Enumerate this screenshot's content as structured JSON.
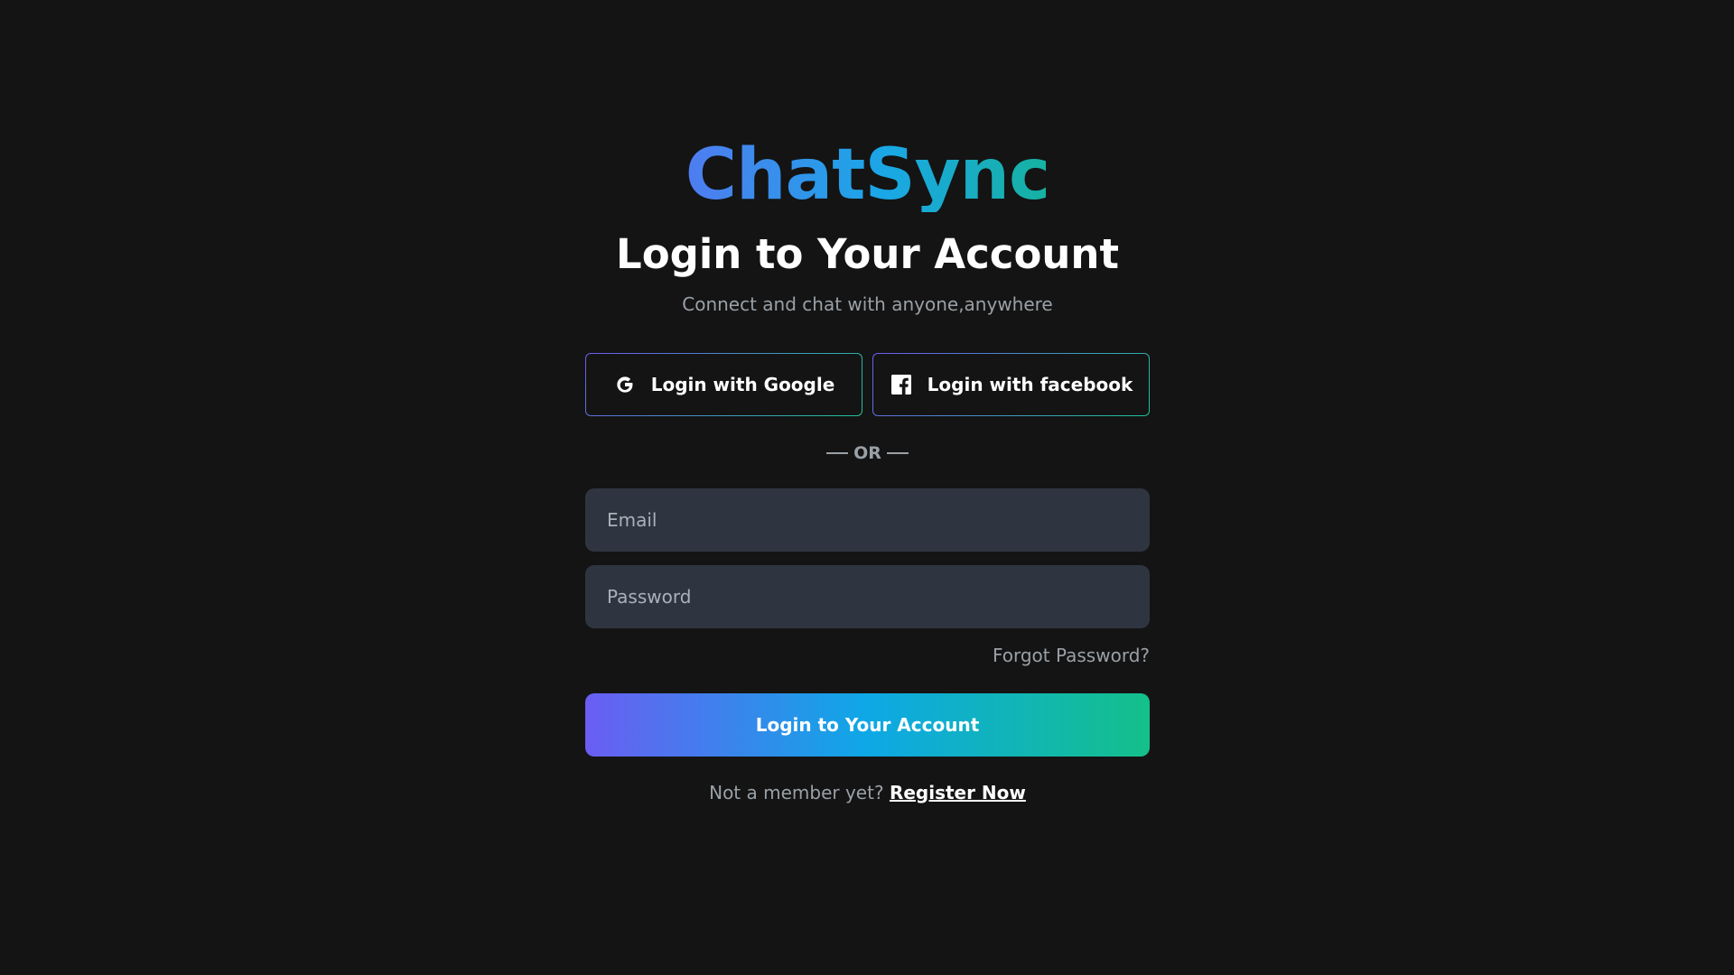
{
  "brand": {
    "name": "ChatSync"
  },
  "header": {
    "title": "Login to Your Account",
    "subtitle": "Connect and chat with anyone,anywhere"
  },
  "social": {
    "google_label": "Login with Google",
    "google_icon": "google-icon",
    "facebook_label": "Login with facebook",
    "facebook_icon": "facebook-icon"
  },
  "divider": {
    "label": "OR"
  },
  "form": {
    "email_placeholder": "Email",
    "email_value": "",
    "password_placeholder": "Password",
    "password_value": "",
    "forgot_label": "Forgot Password?",
    "submit_label": "Login to Your Account"
  },
  "footer": {
    "prompt": "Not a member yet?",
    "register_label": "Register Now"
  },
  "colors": {
    "background": "#141414",
    "input_background": "#2f3540",
    "gradient_start": "#6a5ef2",
    "gradient_mid": "#0ea8e6",
    "gradient_end": "#14c08a",
    "muted_text": "#9aa0a6"
  }
}
